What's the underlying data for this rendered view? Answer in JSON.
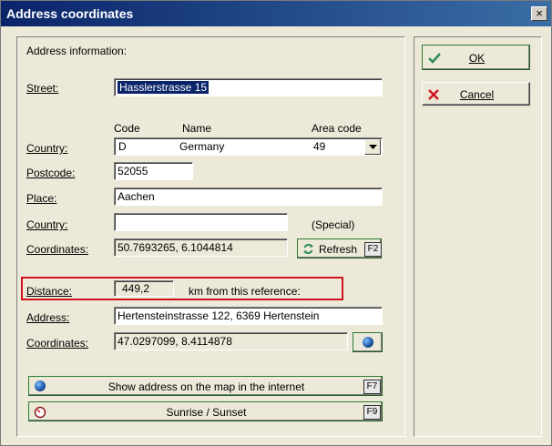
{
  "window": {
    "title": "Address coordinates",
    "close_glyph": "×"
  },
  "address_info": {
    "section_label": "Address information:",
    "street_label": "Street:",
    "street_value": "Hasslerstrasse 15",
    "col_code": "Code",
    "col_name": "Name",
    "col_area_code": "Area code",
    "country_label": "Country:",
    "country_code": "D",
    "country_name": "Germany",
    "country_area_code": "49",
    "postcode_label": "Postcode:",
    "postcode_value": "52055",
    "place_label": "Place:",
    "place_value": "Aachen",
    "country_special_label": "Country:",
    "country_special_value": "",
    "special_label": "(Special)",
    "coords_label": "Coordinates:",
    "coords_value": "50.7693265, 6.1044814",
    "refresh_label": "Refresh",
    "refresh_key": "F2"
  },
  "distance": {
    "label": "Distance:",
    "value": "449,2",
    "suffix": "km from this reference:"
  },
  "reference": {
    "address_label": "Address:",
    "address_value": "Hertensteinstrasse 122, 6369 Hertenstein",
    "coords_label": "Coordinates:",
    "coords_value": "47.0297099, 8.4114878"
  },
  "actions": {
    "show_map_label": "Show address on the map in the internet",
    "show_map_key": "F7",
    "sunrise_label": "Sunrise / Sunset",
    "sunrise_key": "F9"
  },
  "buttons": {
    "ok_label": "OK",
    "cancel_label": "Cancel"
  },
  "colors": {
    "title_bar": "#0a246a",
    "highlight_red": "#d0141e",
    "ok_check": "#2e8b57",
    "cancel_x": "#d0141e"
  }
}
